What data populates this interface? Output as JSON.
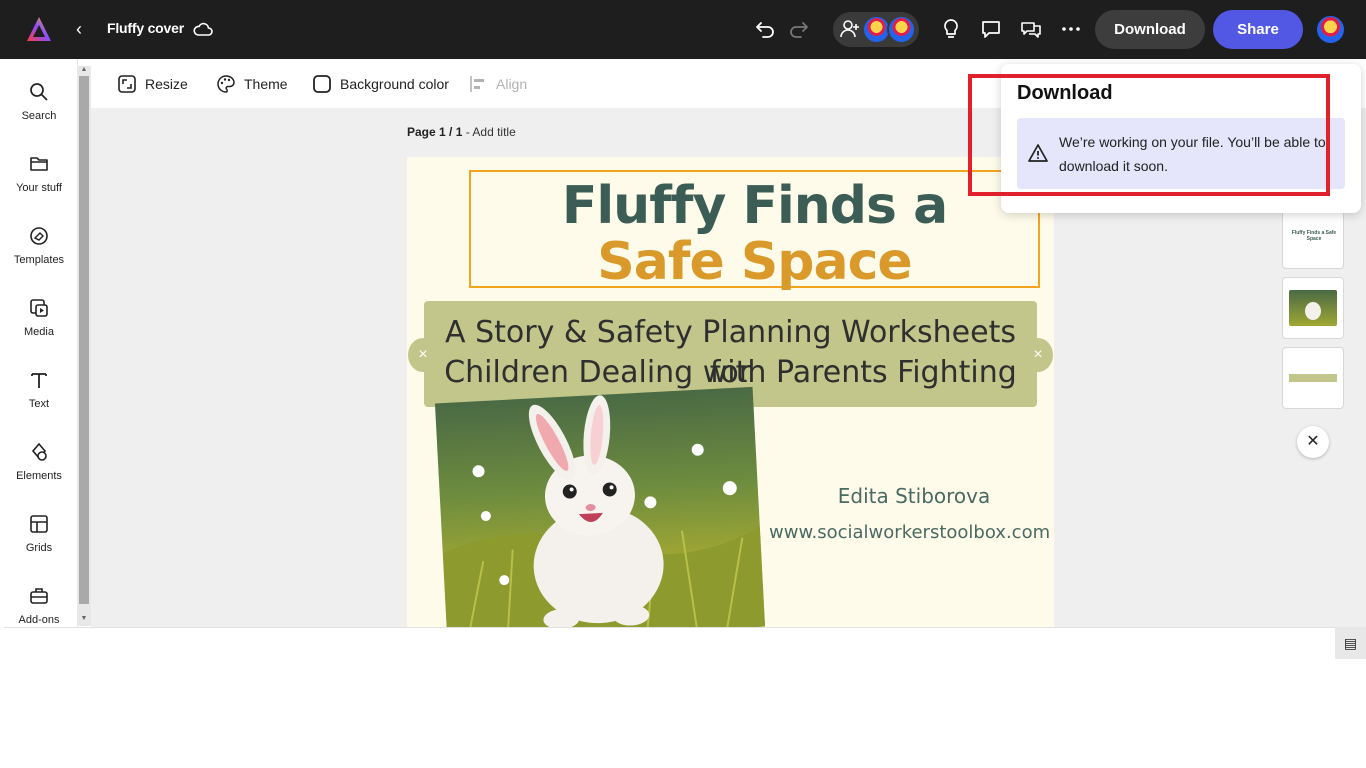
{
  "header": {
    "title": "Fluffy cover",
    "download_label": "Download",
    "share_label": "Share"
  },
  "sidebar": {
    "items": [
      {
        "label": "Search",
        "icon": "search-icon"
      },
      {
        "label": "Your stuff",
        "icon": "folder-icon"
      },
      {
        "label": "Templates",
        "icon": "templates-icon"
      },
      {
        "label": "Media",
        "icon": "media-icon"
      },
      {
        "label": "Text",
        "icon": "text-icon"
      },
      {
        "label": "Elements",
        "icon": "elements-icon"
      },
      {
        "label": "Grids",
        "icon": "grids-icon"
      },
      {
        "label": "Add-ons",
        "icon": "add-ons-icon"
      }
    ]
  },
  "toolbar": {
    "resize": "Resize",
    "theme": "Theme",
    "background_color": "Background color",
    "align": "Align"
  },
  "page_label": {
    "prefix": "Page 1 / 1",
    "separator": " - ",
    "add_title": "Add title"
  },
  "design": {
    "title_line1": "Fluffy Finds a",
    "title_line2": "Safe Space",
    "subtitle_line1": "A Story & Safety Planning Worksheets for",
    "subtitle_line2": "Children Dealing with Parents Fighting",
    "author": "Edita Stiborova",
    "website": "www.socialworkerstoolbox.com",
    "colors": {
      "title_dark": "#3b5d55",
      "title_gold": "#d99a2b",
      "banner": "#c2c68a",
      "page_bg": "#fefbea"
    }
  },
  "thumbnails": {
    "thumb1_text": "Fluffy Finds a Safe Space"
  },
  "download_popover": {
    "heading": "Download",
    "message": "We’re working on your file. You’ll be able to download it soon."
  },
  "colors": {
    "topbar": "#1e1e1e",
    "share_button": "#5258e4",
    "highlight": "#e0202a"
  }
}
